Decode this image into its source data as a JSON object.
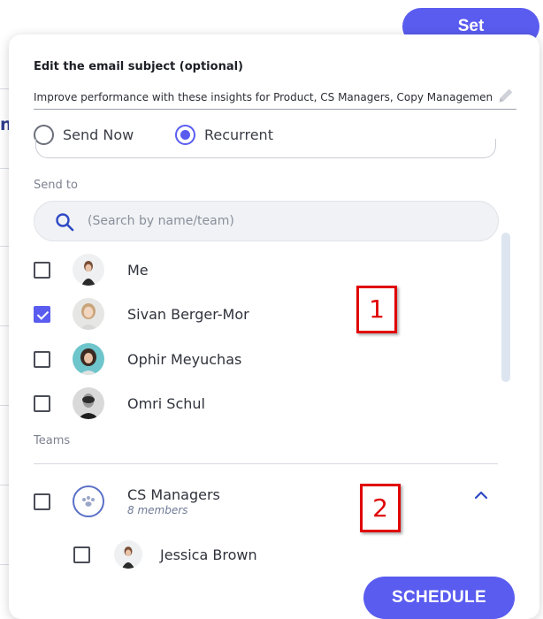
{
  "background": {
    "set_button_label": "Set",
    "title_fragment": "nt"
  },
  "modal": {
    "subject_label": "Edit the email subject (optional)",
    "subject_value": "Improve performance with these insights for Product, CS Managers, Copy Management",
    "send_options": [
      {
        "label": "Send Now",
        "selected": false
      },
      {
        "label": "Recurrent",
        "selected": true
      }
    ],
    "send_to_label": "Send to",
    "search_placeholder": "(Search by name/team)",
    "people": [
      {
        "name": "Me",
        "checked": false
      },
      {
        "name": "Sivan Berger-Mor",
        "checked": true
      },
      {
        "name": "Ophir Meyuchas",
        "checked": false
      },
      {
        "name": "Omri Schul",
        "checked": false
      }
    ],
    "teams_label": "Teams",
    "team": {
      "name": "CS Managers",
      "members": "8 members",
      "checked": false,
      "expanded": true
    },
    "team_members": [
      {
        "name": "Jessica Brown",
        "checked": false
      }
    ],
    "schedule_label": "SCHEDULE"
  },
  "annotations": [
    "1",
    "2"
  ],
  "colors": {
    "accent": "#5a5cf0",
    "annotation": "#e00000"
  }
}
